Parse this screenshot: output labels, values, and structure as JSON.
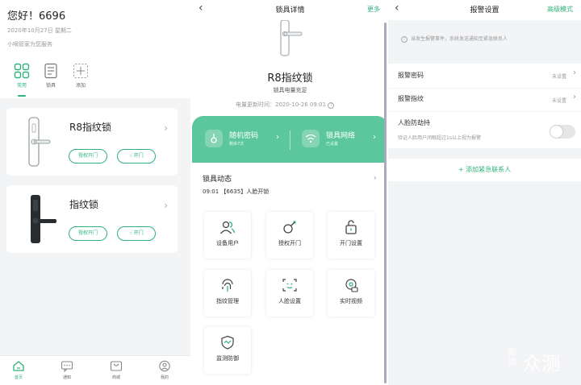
{
  "home": {
    "greeting": "您好！6696",
    "date": "2020年10月27日 星期二",
    "subtitle": "小嘀管家为您服务",
    "tabs": [
      {
        "label": "常用",
        "icon": "grid-icon",
        "active": true
      },
      {
        "label": "锁具",
        "icon": "lock-list-icon"
      },
      {
        "label": "添加",
        "icon": "add-icon"
      }
    ],
    "devices": [
      {
        "name": "R8指纹锁",
        "auth_label": "授权开门",
        "open_label": "开门"
      },
      {
        "name": "指纹锁",
        "auth_label": "授权开门",
        "open_label": "开门"
      }
    ],
    "bottom_nav": [
      {
        "label": "首页",
        "icon": "home-icon",
        "active": true
      },
      {
        "label": "通知",
        "icon": "message-icon"
      },
      {
        "label": "商城",
        "icon": "store-icon"
      },
      {
        "label": "我的",
        "icon": "profile-icon"
      }
    ],
    "accent_color": "#2fb27c"
  },
  "detail": {
    "title": "锁具详情",
    "more_label": "更多",
    "lock_name": "R8指纹锁",
    "battery_status": "锁具电量充足",
    "updated": "电量更新时间：2020-10-26 09:01",
    "random_pwd_label": "随机密码",
    "random_pwd_sub": "剩余7次",
    "network_label": "锁具网络",
    "network_sub": "已设置",
    "activity_title": "锁具动态",
    "activity_line": "09:01 【6635】人脸开锁",
    "grid": [
      {
        "label": "设备用户",
        "icon": "users-icon"
      },
      {
        "label": "授权开门",
        "icon": "key-icon"
      },
      {
        "label": "开门设置",
        "icon": "unlock-icon"
      },
      {
        "label": "指纹管理",
        "icon": "fingerprint-icon"
      },
      {
        "label": "人脸设置",
        "icon": "face-icon"
      },
      {
        "label": "实时视频",
        "icon": "video-icon"
      },
      {
        "label": "监测防御",
        "icon": "shield-icon"
      }
    ],
    "band_color": "#5cc79c"
  },
  "alarm": {
    "title": "报警设置",
    "mode_label": "高级模式",
    "notice": "当发生报警事件，系统发送通知至紧急联系人",
    "alarm_pwd_label": "报警密码",
    "alarm_pwd_value": "未设置",
    "alarm_fp_label": "报警指纹",
    "alarm_fp_value": "未设置",
    "face_label": "人脸防劫持",
    "face_desc": "验证人脸用户闭眼超过1s以上视为报警",
    "face_enabled": false,
    "add_contact": "+ 添加紧急联系人"
  },
  "watermark": {
    "small": "新浪",
    "large": "众测"
  }
}
